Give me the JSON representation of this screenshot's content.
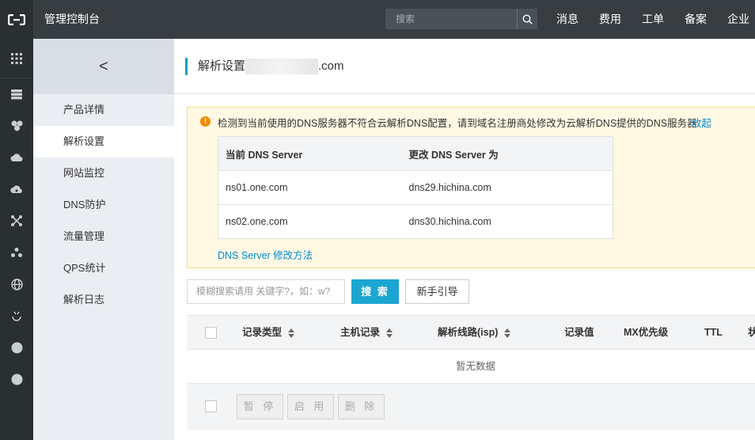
{
  "topbar": {
    "title": "管理控制台",
    "search_placeholder": "搜索",
    "nav": [
      "消息",
      "费用",
      "工单",
      "备案",
      "企业"
    ]
  },
  "rail_icons": [
    "apps-grid-icon",
    "server-icon",
    "cluster-icon",
    "cloud-database-icon",
    "cloud-speed-icon",
    "network-nodes-icon",
    "hierarchy-icon",
    "globe-icon",
    "monitor-icon",
    "circle-icon",
    "circle-icon"
  ],
  "subnav": {
    "back": "<",
    "items": [
      "产品详情",
      "解析设置",
      "网站监控",
      "DNS防护",
      "流量管理",
      "QPS统计",
      "解析日志"
    ],
    "active_index": 1
  },
  "page": {
    "title": "解析设置",
    "domain_suffix": ".com"
  },
  "notice": {
    "text": "检测到当前使用的DNS服务器不符合云解析DNS配置，请到域名注册商处修改为云解析DNS提供的DNS服务器",
    "collapse": "收起",
    "table": {
      "headers": [
        "当前 DNS Server",
        "更改 DNS Server 为"
      ],
      "rows": [
        [
          "ns01.one.com",
          "dns29.hichina.com"
        ],
        [
          "ns02.one.com",
          "dns30.hichina.com"
        ]
      ]
    },
    "footer_link": "DNS Server 修改方法"
  },
  "filter": {
    "placeholder": "模糊搜索请用 关键字?，如：w?",
    "search_button": "搜 索",
    "guide_button": "新手引导"
  },
  "records": {
    "headers": [
      "记录类型",
      "主机记录",
      "解析线路(isp)",
      "记录值",
      "MX优先级",
      "TTL",
      "状"
    ],
    "empty": "暂无数据",
    "actions": [
      "暂 停",
      "启 用",
      "删 除"
    ]
  },
  "colors": {
    "topbar": "#373d41",
    "accent": "#00a2ca",
    "primary_button": "#1ba6d1",
    "notice_bg": "#fff8e3",
    "link": "#0089d2"
  }
}
